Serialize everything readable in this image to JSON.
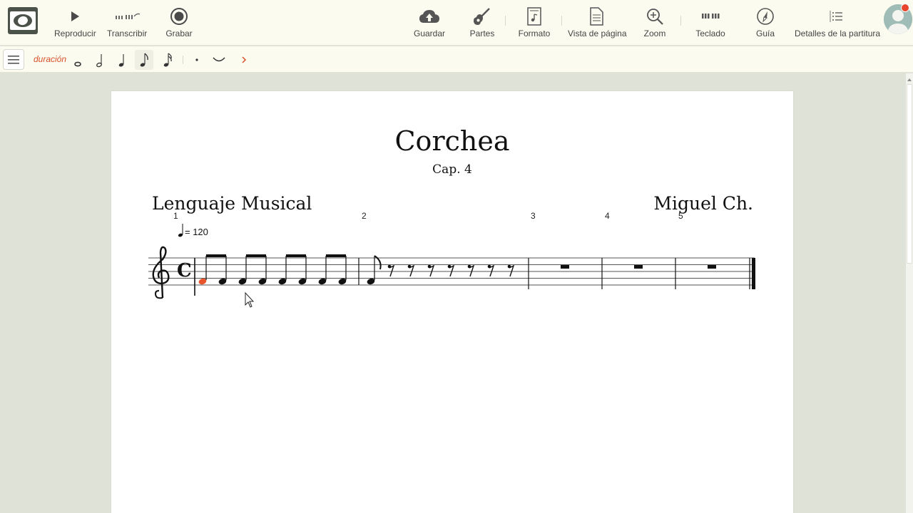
{
  "toolbar": {
    "play": "Reproducir",
    "transcribe": "Transcribir",
    "record": "Grabar",
    "save": "Guardar",
    "parts": "Partes",
    "format": "Formato",
    "page_view": "Vista de página",
    "zoom": "Zoom",
    "keyboard": "Teclado",
    "guide": "Guía",
    "details": "Detalles de la partitura"
  },
  "subtoolbar": {
    "duration_label": "duración",
    "durations": [
      "whole-note",
      "half-note",
      "quarter-note",
      "eighth-note",
      "sixteenth-note"
    ],
    "active_duration": "eighth-note"
  },
  "score": {
    "title": "Corchea",
    "subtitle": "Cap. 4",
    "lyricist": "Lenguaje Musical",
    "composer": "Miguel Ch.",
    "tempo": "= 120",
    "measure_numbers": [
      "1",
      "2",
      "3",
      "4",
      "5"
    ],
    "clef": "treble",
    "time_signature": "C",
    "selected_note_color": "#e8542c"
  },
  "colors": {
    "toolbar_bg": "#fbfbf0",
    "workspace_bg": "#dfe3d7",
    "accent": "#d9502a"
  }
}
